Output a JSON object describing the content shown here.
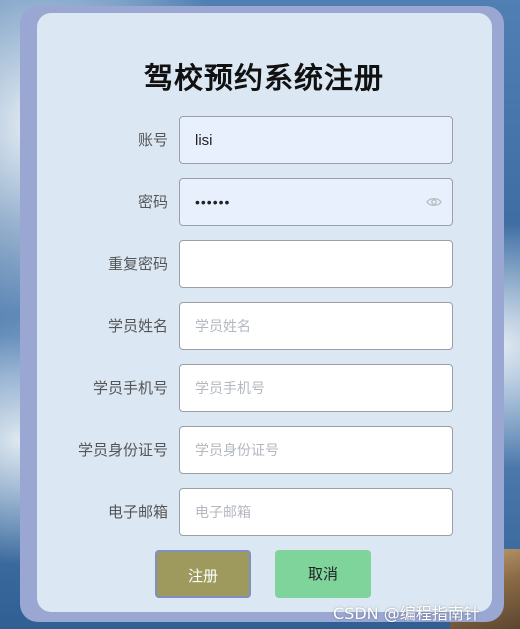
{
  "form": {
    "title": "驾校预约系统注册",
    "fields": [
      {
        "label": "账号",
        "value": "lisi",
        "placeholder": "",
        "type": "text"
      },
      {
        "label": "密码",
        "value": "••••••",
        "placeholder": "",
        "type": "password"
      },
      {
        "label": "重复密码",
        "value": "",
        "placeholder": "",
        "type": "password"
      },
      {
        "label": "学员姓名",
        "value": "",
        "placeholder": "学员姓名",
        "type": "text"
      },
      {
        "label": "学员手机号",
        "value": "",
        "placeholder": "学员手机号",
        "type": "text"
      },
      {
        "label": "学员身份证号",
        "value": "",
        "placeholder": "学员身份证号",
        "type": "text"
      },
      {
        "label": "电子邮箱",
        "value": "",
        "placeholder": "电子邮箱",
        "type": "text"
      }
    ],
    "register_label": "注册",
    "cancel_label": "取消"
  },
  "watermark": "CSDN @编程指南针",
  "icons": {
    "password_toggle": "eye-icon"
  },
  "colors": {
    "card_bg": "#dbe7f3",
    "frame": "#9aa7d3",
    "register_button": "#9e9a5e",
    "cancel_button": "#7fd49c",
    "autofill_bg": "#e8f0fe"
  }
}
